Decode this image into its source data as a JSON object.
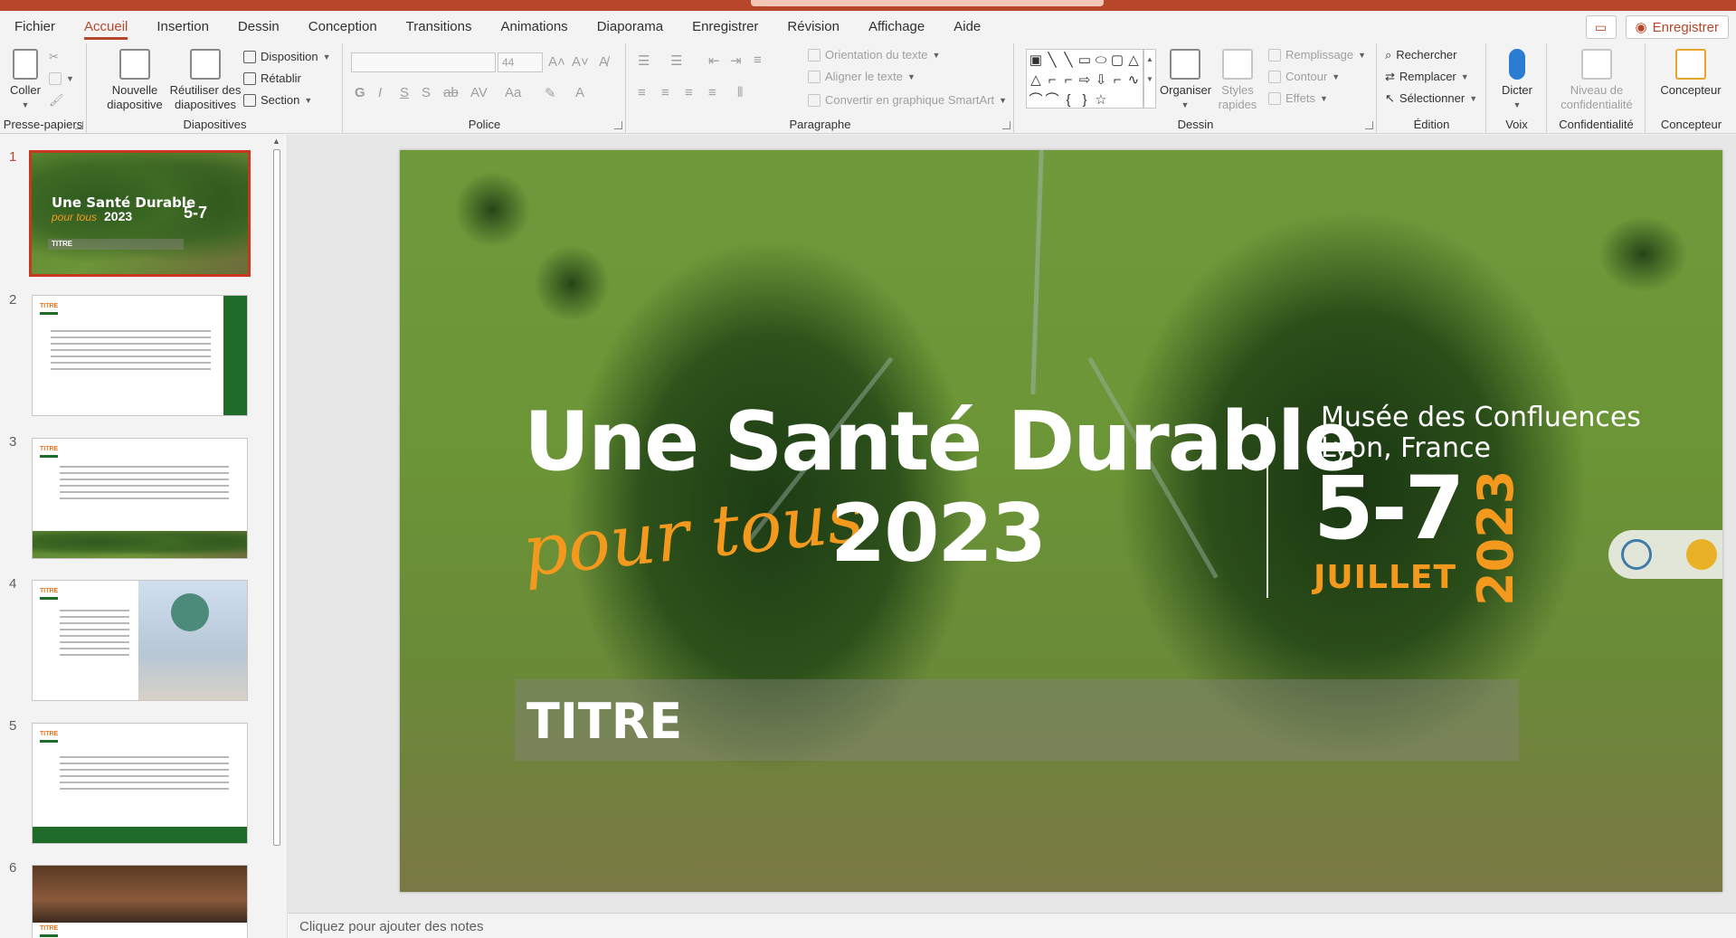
{
  "menu": {
    "tabs": [
      "Fichier",
      "Accueil",
      "Insertion",
      "Dessin",
      "Conception",
      "Transitions",
      "Animations",
      "Diaporama",
      "Enregistrer",
      "Révision",
      "Affichage",
      "Aide"
    ],
    "active": "Accueil",
    "save_label": "Enregistrer"
  },
  "ribbon": {
    "clipboard": {
      "paste": "Coller",
      "label": "Presse-papiers"
    },
    "slides": {
      "new": "Nouvelle diapositive",
      "reuse": "Réutiliser des diapositives",
      "layout": "Disposition",
      "reset": "Rétablir",
      "section": "Section",
      "label": "Diapositives"
    },
    "font": {
      "size": "44",
      "label": "Police",
      "bold": "G",
      "italic": "I",
      "underline": "S",
      "shadow": "S",
      "strike": "ab",
      "spacing": "AV",
      "case": "Aa"
    },
    "paragraph": {
      "text_direction": "Orientation du texte",
      "align_text": "Aligner le texte",
      "smartart": "Convertir en graphique SmartArt",
      "label": "Paragraphe"
    },
    "drawing": {
      "arrange": "Organiser",
      "quick_styles": "Styles rapides",
      "fill": "Remplissage",
      "outline": "Contour",
      "effects": "Effets",
      "label": "Dessin"
    },
    "editing": {
      "find": "Rechercher",
      "replace": "Remplacer",
      "select": "Sélectionner",
      "label": "Édition"
    },
    "voice": {
      "dictate": "Dicter",
      "label": "Voix"
    },
    "sensitivity": {
      "level": "Niveau de confidentialité",
      "label": "Confidentialité"
    },
    "designer": {
      "btn": "Concepteur",
      "label": "Concepteur"
    }
  },
  "thumbnails": {
    "numbers": [
      "1",
      "2",
      "3",
      "4",
      "5",
      "6"
    ],
    "title": "TITRE",
    "slide1_line1": "Une Santé Durable",
    "slide1_line2": "pour tous",
    "slide1_year": "2023",
    "slide1_dates": "5-7"
  },
  "slide": {
    "line1": "Une Santé Durable",
    "script": "pour tous",
    "year": "2023",
    "venue1": "Musée des Confluences",
    "venue2": "Lyon, France",
    "dates": "5-7",
    "month": "JUILLET",
    "year_vertical": "2023",
    "title": "TITRE"
  },
  "notes": {
    "placeholder": "Cliquez pour ajouter des notes"
  },
  "colors": {
    "accent": "#b7472a",
    "orange": "#f39a1e",
    "green": "#1e6b2a"
  }
}
